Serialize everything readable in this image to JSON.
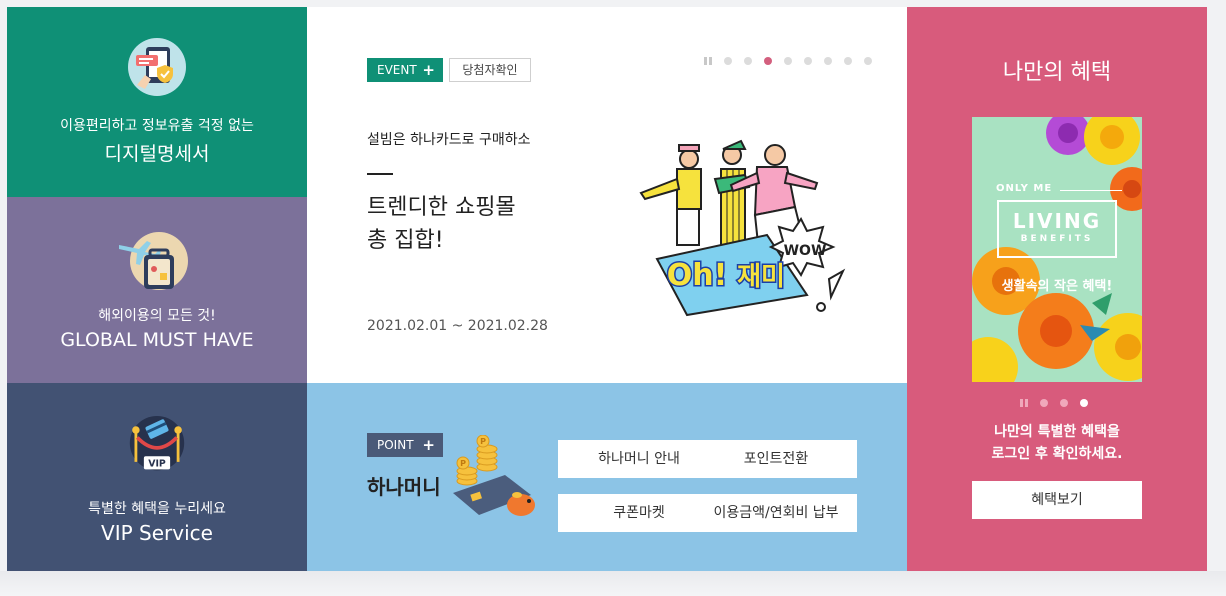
{
  "colors": {
    "teal": "#0f9076",
    "purple": "#7c719a",
    "navy": "#425273",
    "blue": "#8cc4e6",
    "pink": "#d85b7c"
  },
  "left": {
    "digital": {
      "subtitle": "이용편리하고 정보유출 걱정 없는",
      "title": "디지털명세서",
      "icon": "phone-shield-icon"
    },
    "global": {
      "subtitle": "해외이용의 모든 것!",
      "title": "GLOBAL MUST HAVE",
      "icon": "airplane-suitcase-icon"
    },
    "vip": {
      "subtitle": "특별한 혜택을 누리세요",
      "title": "VIP Service",
      "icon": "vip-card-icon",
      "badge": "VIP"
    }
  },
  "event": {
    "tag": "EVENT",
    "tag_plus": "+",
    "check_label": "당첨자확인",
    "subtitle": "설빔은 하나카드로 구매하소",
    "title": "트렌디한 쇼핑몰\n총 집합!",
    "date": "2021.02.01 ~ 2021.02.28",
    "slides": 8,
    "active_slide": 3,
    "art_text_main": "Oh!",
    "art_text_korean": "재미",
    "art_text_burst": "WOW"
  },
  "point": {
    "tag": "POINT",
    "tag_plus": "+",
    "title": "하나머니",
    "buttons": [
      "하나머니 안내",
      "포인트전환",
      "쿠폰마켓",
      "이용금액/연회비 납부"
    ],
    "coin_label": "P"
  },
  "mine": {
    "title": "나만의 혜택",
    "banner": {
      "only": "ONLY ME",
      "living": "LIVING",
      "benefits": "BENEFITS",
      "korean": "생활속의 작은 혜택!"
    },
    "slides": 3,
    "active_slide": 3,
    "message": "나만의 특별한 혜택을\n로그인 후 확인하세요.",
    "button": "혜택보기"
  }
}
